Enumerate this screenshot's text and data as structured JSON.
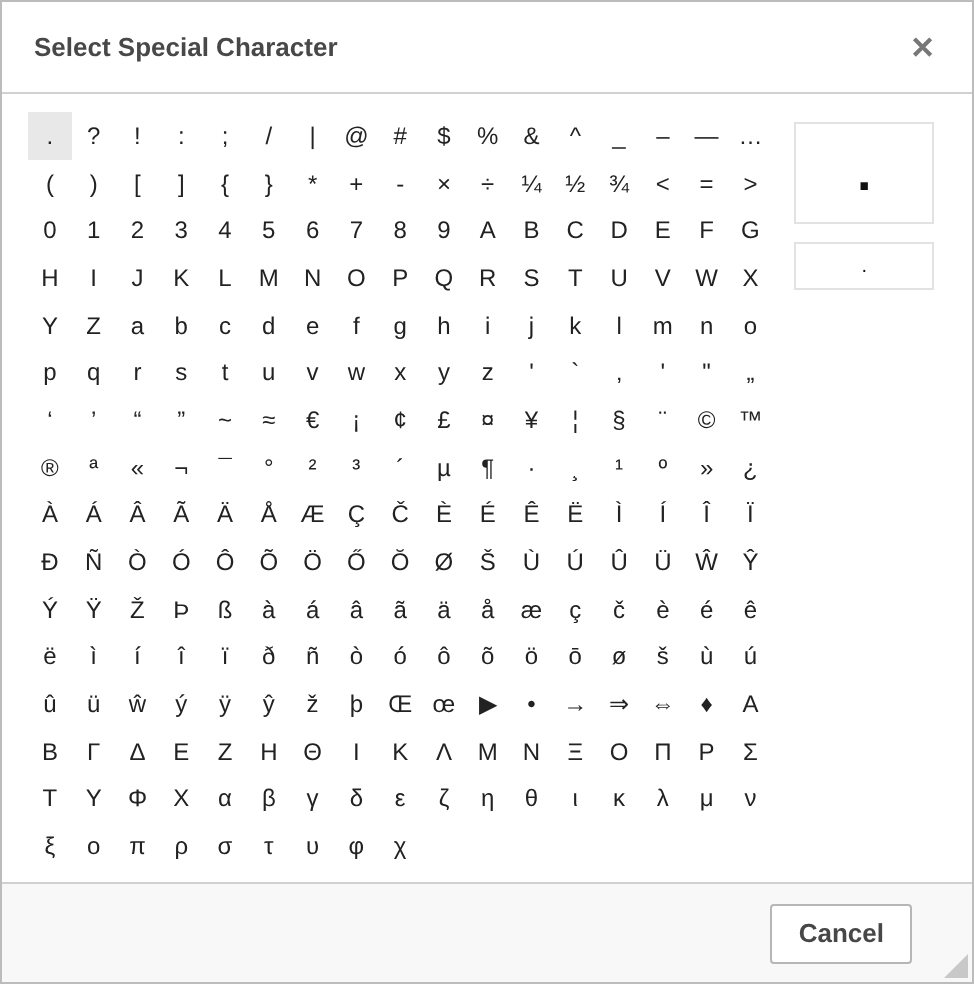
{
  "dialog": {
    "title": "Select Special Character",
    "close": "✕"
  },
  "rows": [
    [
      {
        "char": ".",
        "selected": true
      },
      {
        "char": "?",
        "selected": false
      },
      {
        "char": "!",
        "selected": false
      },
      {
        "char": ":",
        "selected": false
      },
      {
        "char": ";",
        "selected": false
      },
      {
        "char": "/",
        "selected": false
      },
      {
        "char": "|",
        "selected": false
      },
      {
        "char": "@",
        "selected": false
      },
      {
        "char": "#",
        "selected": false
      },
      {
        "char": "$",
        "selected": false
      },
      {
        "char": "%",
        "selected": false
      },
      {
        "char": "&",
        "selected": false
      },
      {
        "char": "^",
        "selected": false
      },
      {
        "char": "_",
        "selected": false
      },
      {
        "char": "–",
        "selected": false
      },
      {
        "char": "—",
        "selected": false
      },
      {
        "char": "…",
        "selected": false
      }
    ],
    [
      {
        "char": "(",
        "selected": false
      },
      {
        "char": ")",
        "selected": false
      },
      {
        "char": "[",
        "selected": false
      },
      {
        "char": "]",
        "selected": false
      },
      {
        "char": "{",
        "selected": false
      },
      {
        "char": "}",
        "selected": false
      },
      {
        "char": "*",
        "selected": false
      },
      {
        "char": "+",
        "selected": false
      },
      {
        "char": "-",
        "selected": false
      },
      {
        "char": "×",
        "selected": false
      },
      {
        "char": "÷",
        "selected": false
      },
      {
        "char": "¼",
        "selected": false
      },
      {
        "char": "½",
        "selected": false
      },
      {
        "char": "¾",
        "selected": false
      },
      {
        "char": "<",
        "selected": false
      },
      {
        "char": "=",
        "selected": false
      },
      {
        "char": ">",
        "selected": false
      }
    ],
    [
      {
        "char": "0",
        "selected": false
      },
      {
        "char": "1",
        "selected": false
      },
      {
        "char": "2",
        "selected": false
      },
      {
        "char": "3",
        "selected": false
      },
      {
        "char": "4",
        "selected": false
      },
      {
        "char": "5",
        "selected": false
      },
      {
        "char": "6",
        "selected": false
      },
      {
        "char": "7",
        "selected": false
      },
      {
        "char": "8",
        "selected": false
      },
      {
        "char": "9",
        "selected": false
      },
      {
        "char": "A",
        "selected": false
      },
      {
        "char": "B",
        "selected": false
      },
      {
        "char": "C",
        "selected": false
      },
      {
        "char": "D",
        "selected": false
      },
      {
        "char": "E",
        "selected": false
      },
      {
        "char": "F",
        "selected": false
      },
      {
        "char": "G",
        "selected": false
      }
    ],
    [
      {
        "char": "H",
        "selected": false
      },
      {
        "char": "I",
        "selected": false
      },
      {
        "char": "J",
        "selected": false
      },
      {
        "char": "K",
        "selected": false
      },
      {
        "char": "L",
        "selected": false
      },
      {
        "char": "M",
        "selected": false
      },
      {
        "char": "N",
        "selected": false
      },
      {
        "char": "O",
        "selected": false
      },
      {
        "char": "P",
        "selected": false
      },
      {
        "char": "Q",
        "selected": false
      },
      {
        "char": "R",
        "selected": false
      },
      {
        "char": "S",
        "selected": false
      },
      {
        "char": "T",
        "selected": false
      },
      {
        "char": "U",
        "selected": false
      },
      {
        "char": "V",
        "selected": false
      },
      {
        "char": "W",
        "selected": false
      },
      {
        "char": "X",
        "selected": false
      }
    ],
    [
      {
        "char": "Y",
        "selected": false
      },
      {
        "char": "Z",
        "selected": false
      },
      {
        "char": "a",
        "selected": false
      },
      {
        "char": "b",
        "selected": false
      },
      {
        "char": "c",
        "selected": false
      },
      {
        "char": "d",
        "selected": false
      },
      {
        "char": "e",
        "selected": false
      },
      {
        "char": "f",
        "selected": false
      },
      {
        "char": "g",
        "selected": false
      },
      {
        "char": "h",
        "selected": false
      },
      {
        "char": "i",
        "selected": false
      },
      {
        "char": "j",
        "selected": false
      },
      {
        "char": "k",
        "selected": false
      },
      {
        "char": "l",
        "selected": false
      },
      {
        "char": "m",
        "selected": false
      },
      {
        "char": "n",
        "selected": false
      },
      {
        "char": "o",
        "selected": false
      }
    ],
    [
      {
        "char": "p",
        "selected": false
      },
      {
        "char": "q",
        "selected": false
      },
      {
        "char": "r",
        "selected": false
      },
      {
        "char": "s",
        "selected": false
      },
      {
        "char": "t",
        "selected": false
      },
      {
        "char": "u",
        "selected": false
      },
      {
        "char": "v",
        "selected": false
      },
      {
        "char": "w",
        "selected": false
      },
      {
        "char": "x",
        "selected": false
      },
      {
        "char": "y",
        "selected": false
      },
      {
        "char": "z",
        "selected": false
      },
      {
        "char": "'",
        "selected": false
      },
      {
        "char": "`",
        "selected": false
      },
      {
        "char": "‚",
        "selected": false
      },
      {
        "char": "'",
        "selected": false
      },
      {
        "char": "\"",
        "selected": false
      },
      {
        "char": "„",
        "selected": false
      }
    ],
    [
      {
        "char": "‘",
        "selected": false
      },
      {
        "char": "’",
        "selected": false
      },
      {
        "char": "“",
        "selected": false
      },
      {
        "char": "”",
        "selected": false
      },
      {
        "char": "~",
        "selected": false
      },
      {
        "char": "≈",
        "selected": false
      },
      {
        "char": "€",
        "selected": false
      },
      {
        "char": "¡",
        "selected": false
      },
      {
        "char": "¢",
        "selected": false
      },
      {
        "char": "£",
        "selected": false
      },
      {
        "char": "¤",
        "selected": false
      },
      {
        "char": "¥",
        "selected": false
      },
      {
        "char": "¦",
        "selected": false
      },
      {
        "char": "§",
        "selected": false
      },
      {
        "char": "¨",
        "selected": false
      },
      {
        "char": "©",
        "selected": false
      },
      {
        "char": "™",
        "selected": false
      }
    ],
    [
      {
        "char": "®",
        "selected": false
      },
      {
        "char": "ª",
        "selected": false
      },
      {
        "char": "«",
        "selected": false
      },
      {
        "char": "¬",
        "selected": false
      },
      {
        "char": "¯",
        "selected": false
      },
      {
        "char": "°",
        "selected": false
      },
      {
        "char": "²",
        "selected": false
      },
      {
        "char": "³",
        "selected": false
      },
      {
        "char": "´",
        "selected": false
      },
      {
        "char": "µ",
        "selected": false
      },
      {
        "char": "¶",
        "selected": false
      },
      {
        "char": "·",
        "selected": false
      },
      {
        "char": "¸",
        "selected": false
      },
      {
        "char": "¹",
        "selected": false
      },
      {
        "char": "º",
        "selected": false
      },
      {
        "char": "»",
        "selected": false
      },
      {
        "char": "¿",
        "selected": false
      }
    ],
    [
      {
        "char": "À",
        "selected": false
      },
      {
        "char": "Á",
        "selected": false
      },
      {
        "char": "Â",
        "selected": false
      },
      {
        "char": "Ã",
        "selected": false
      },
      {
        "char": "Ä",
        "selected": false
      },
      {
        "char": "Å",
        "selected": false
      },
      {
        "char": "Æ",
        "selected": false
      },
      {
        "char": "Ç",
        "selected": false
      },
      {
        "char": "Č",
        "selected": false
      },
      {
        "char": "È",
        "selected": false
      },
      {
        "char": "É",
        "selected": false
      },
      {
        "char": "Ê",
        "selected": false
      },
      {
        "char": "Ë",
        "selected": false
      },
      {
        "char": "Ì",
        "selected": false
      },
      {
        "char": "Í",
        "selected": false
      },
      {
        "char": "Î",
        "selected": false
      },
      {
        "char": "Ï",
        "selected": false
      }
    ],
    [
      {
        "char": "Ð",
        "selected": false
      },
      {
        "char": "Ñ",
        "selected": false
      },
      {
        "char": "Ò",
        "selected": false
      },
      {
        "char": "Ó",
        "selected": false
      },
      {
        "char": "Ô",
        "selected": false
      },
      {
        "char": "Õ",
        "selected": false
      },
      {
        "char": "Ö",
        "selected": false
      },
      {
        "char": "Ő",
        "selected": false
      },
      {
        "char": "Ŏ",
        "selected": false
      },
      {
        "char": "Ø",
        "selected": false
      },
      {
        "char": "Š",
        "selected": false
      },
      {
        "char": "Ù",
        "selected": false
      },
      {
        "char": "Ú",
        "selected": false
      },
      {
        "char": "Û",
        "selected": false
      },
      {
        "char": "Ü",
        "selected": false
      },
      {
        "char": "Ŵ",
        "selected": false
      },
      {
        "char": "Ŷ",
        "selected": false
      }
    ],
    [
      {
        "char": "Ý",
        "selected": false
      },
      {
        "char": "Ÿ",
        "selected": false
      },
      {
        "char": "Ž",
        "selected": false
      },
      {
        "char": "Þ",
        "selected": false
      },
      {
        "char": "ß",
        "selected": false
      },
      {
        "char": "à",
        "selected": false
      },
      {
        "char": "á",
        "selected": false
      },
      {
        "char": "â",
        "selected": false
      },
      {
        "char": "ã",
        "selected": false
      },
      {
        "char": "ä",
        "selected": false
      },
      {
        "char": "å",
        "selected": false
      },
      {
        "char": "æ",
        "selected": false
      },
      {
        "char": "ç",
        "selected": false
      },
      {
        "char": "č",
        "selected": false
      },
      {
        "char": "è",
        "selected": false
      },
      {
        "char": "é",
        "selected": false
      },
      {
        "char": "ê",
        "selected": false
      }
    ],
    [
      {
        "char": "ë",
        "selected": false
      },
      {
        "char": "ì",
        "selected": false
      },
      {
        "char": "í",
        "selected": false
      },
      {
        "char": "î",
        "selected": false
      },
      {
        "char": "ï",
        "selected": false
      },
      {
        "char": "ð",
        "selected": false
      },
      {
        "char": "ñ",
        "selected": false
      },
      {
        "char": "ò",
        "selected": false
      },
      {
        "char": "ó",
        "selected": false
      },
      {
        "char": "ô",
        "selected": false
      },
      {
        "char": "õ",
        "selected": false
      },
      {
        "char": "ö",
        "selected": false
      },
      {
        "char": "ō",
        "selected": false
      },
      {
        "char": "ø",
        "selected": false
      },
      {
        "char": "š",
        "selected": false
      },
      {
        "char": "ù",
        "selected": false
      },
      {
        "char": "ú",
        "selected": false
      }
    ],
    [
      {
        "char": "û",
        "selected": false
      },
      {
        "char": "ü",
        "selected": false
      },
      {
        "char": "ŵ",
        "selected": false
      },
      {
        "char": "ý",
        "selected": false
      },
      {
        "char": "ÿ",
        "selected": false
      },
      {
        "char": "ŷ",
        "selected": false
      },
      {
        "char": "ž",
        "selected": false
      },
      {
        "char": "þ",
        "selected": false
      },
      {
        "char": "Œ",
        "selected": false
      },
      {
        "char": "œ",
        "selected": false
      },
      {
        "char": "▶",
        "selected": false
      },
      {
        "char": "•",
        "selected": false
      },
      {
        "char": "→",
        "selected": false
      },
      {
        "char": "⇒",
        "selected": false
      },
      {
        "char": "⇔",
        "selected": false
      },
      {
        "char": "♦",
        "selected": false
      },
      {
        "char": "Α",
        "selected": false
      }
    ],
    [
      {
        "char": "Β",
        "selected": false
      },
      {
        "char": "Γ",
        "selected": false
      },
      {
        "char": "Δ",
        "selected": false
      },
      {
        "char": "Ε",
        "selected": false
      },
      {
        "char": "Ζ",
        "selected": false
      },
      {
        "char": "Η",
        "selected": false
      },
      {
        "char": "Θ",
        "selected": false
      },
      {
        "char": "Ι",
        "selected": false
      },
      {
        "char": "Κ",
        "selected": false
      },
      {
        "char": "Λ",
        "selected": false
      },
      {
        "char": "Μ",
        "selected": false
      },
      {
        "char": "Ν",
        "selected": false
      },
      {
        "char": "Ξ",
        "selected": false
      },
      {
        "char": "Ο",
        "selected": false
      },
      {
        "char": "Π",
        "selected": false
      },
      {
        "char": "Ρ",
        "selected": false
      },
      {
        "char": "Σ",
        "selected": false
      }
    ],
    [
      {
        "char": "Τ",
        "selected": false
      },
      {
        "char": "Υ",
        "selected": false
      },
      {
        "char": "Φ",
        "selected": false
      },
      {
        "char": "Χ",
        "selected": false
      },
      {
        "char": "α",
        "selected": false
      },
      {
        "char": "β",
        "selected": false
      },
      {
        "char": "γ",
        "selected": false
      },
      {
        "char": "δ",
        "selected": false
      },
      {
        "char": "ε",
        "selected": false
      },
      {
        "char": "ζ",
        "selected": false
      },
      {
        "char": "η",
        "selected": false
      },
      {
        "char": "θ",
        "selected": false
      },
      {
        "char": "ι",
        "selected": false
      },
      {
        "char": "κ",
        "selected": false
      },
      {
        "char": "λ",
        "selected": false
      },
      {
        "char": "μ",
        "selected": false
      },
      {
        "char": "ν",
        "selected": false
      }
    ],
    [
      {
        "char": "ξ",
        "selected": false
      },
      {
        "char": "ο",
        "selected": false
      },
      {
        "char": "π",
        "selected": false
      },
      {
        "char": "ρ",
        "selected": false
      },
      {
        "char": "σ",
        "selected": false
      },
      {
        "char": "τ",
        "selected": false
      },
      {
        "char": "υ",
        "selected": false
      },
      {
        "char": "φ",
        "selected": false
      },
      {
        "char": "χ",
        "selected": false
      }
    ]
  ],
  "preview": {
    "large": ".",
    "small": "."
  },
  "buttons": [
    "Cancel"
  ]
}
